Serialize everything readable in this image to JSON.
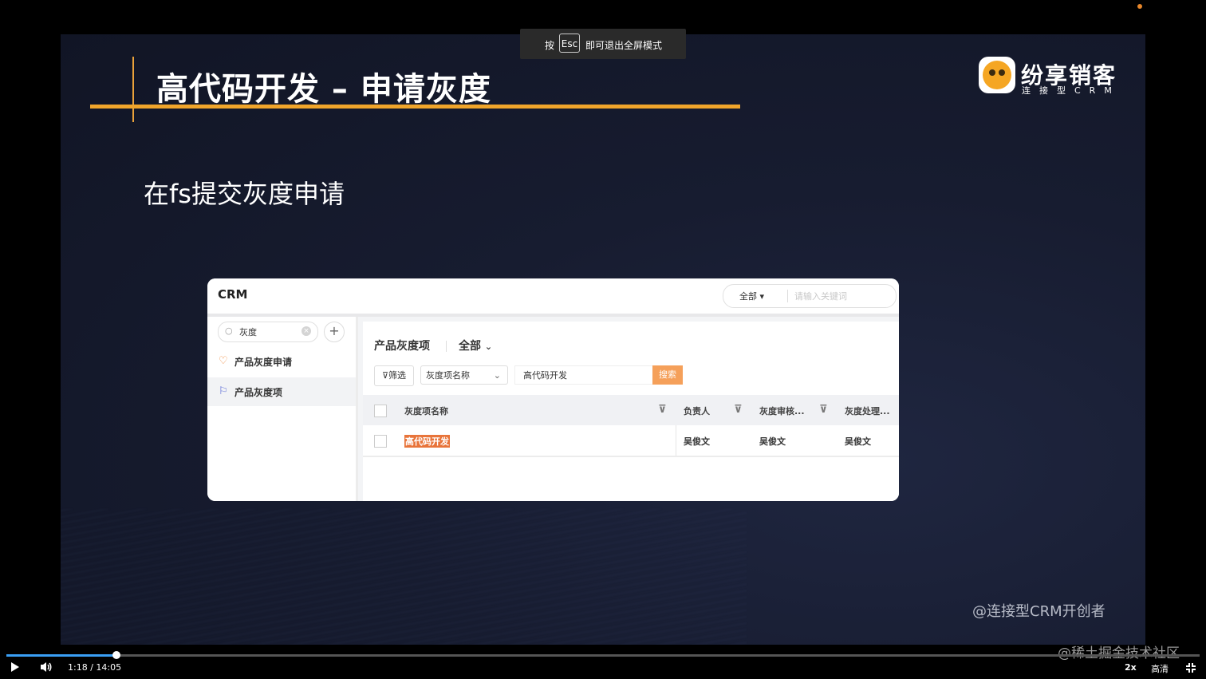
{
  "slide": {
    "title": "高代码开发 – 申请灰度",
    "brand_name": "纷享销客",
    "brand_sub": "连接型CRM",
    "subtitle": "在fs提交灰度申请",
    "footer_watermark": "@连接型CRM开创者",
    "accent_color": "#f0a52b"
  },
  "crm": {
    "logo": "CRM",
    "top_scope": "全部",
    "top_search_placeholder": "请输入关键词",
    "sidebar": {
      "search_value": "灰度",
      "clear_icon": "×",
      "add_icon": "+",
      "items": [
        {
          "label": "产品灰度申请",
          "icon": "♡"
        },
        {
          "label": "产品灰度项",
          "icon": "⚐"
        }
      ]
    },
    "main": {
      "title": "产品灰度项",
      "scope": "全部",
      "filter_label": "筛选",
      "field_select": "灰度项名称",
      "keyword": "高代码开发",
      "search_button": "搜索",
      "columns": [
        "灰度项名称",
        "负责人",
        "灰度审核...",
        "灰度处理..."
      ],
      "rows": [
        {
          "name": "高代码开发",
          "owner": "吴俊文",
          "reviewer": "吴俊文",
          "handler": "吴俊文"
        }
      ]
    }
  },
  "esc_tip": {
    "prefix": "按",
    "key": "Esc",
    "suffix": "即可退出全屏模式"
  },
  "player": {
    "time": "1:18 / 14:05",
    "progress": 0.0925,
    "speed": "2x",
    "quality": "高清",
    "site_watermark": "@稀土掘金技术社区"
  }
}
